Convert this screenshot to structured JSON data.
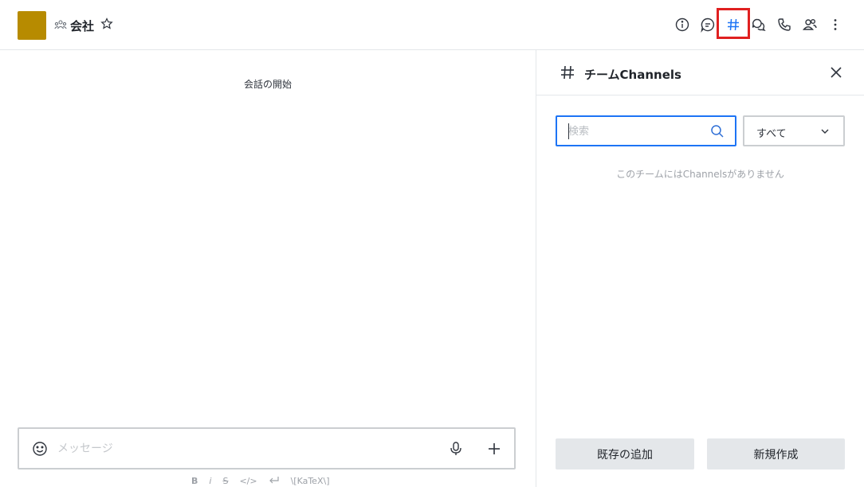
{
  "header": {
    "room_name": "会社",
    "avatar_color": "#b78b00",
    "icons": [
      "info-icon",
      "discussion-icon",
      "team-channels-icon",
      "threads-icon",
      "call-icon",
      "members-icon",
      "kebab-menu-icon"
    ],
    "highlight_color": "#e02020"
  },
  "main": {
    "start_label": "会話の開始",
    "composer": {
      "placeholder": "メッセージ"
    },
    "format_bar": {
      "bold": "B",
      "italic": "i",
      "strike": "S",
      "code": "</>",
      "katex": "\\[KaTeX\\]"
    }
  },
  "panel": {
    "title": "チームChannels",
    "search": {
      "placeholder": "検索"
    },
    "filter": {
      "selected": "すべて"
    },
    "empty_message": "このチームにはChannelsがありません",
    "add_existing_label": "既存の追加",
    "create_new_label": "新規作成"
  },
  "colors": {
    "accent": "#1d74f5",
    "border": "#cbced1",
    "button_bg": "#e4e7ea"
  }
}
